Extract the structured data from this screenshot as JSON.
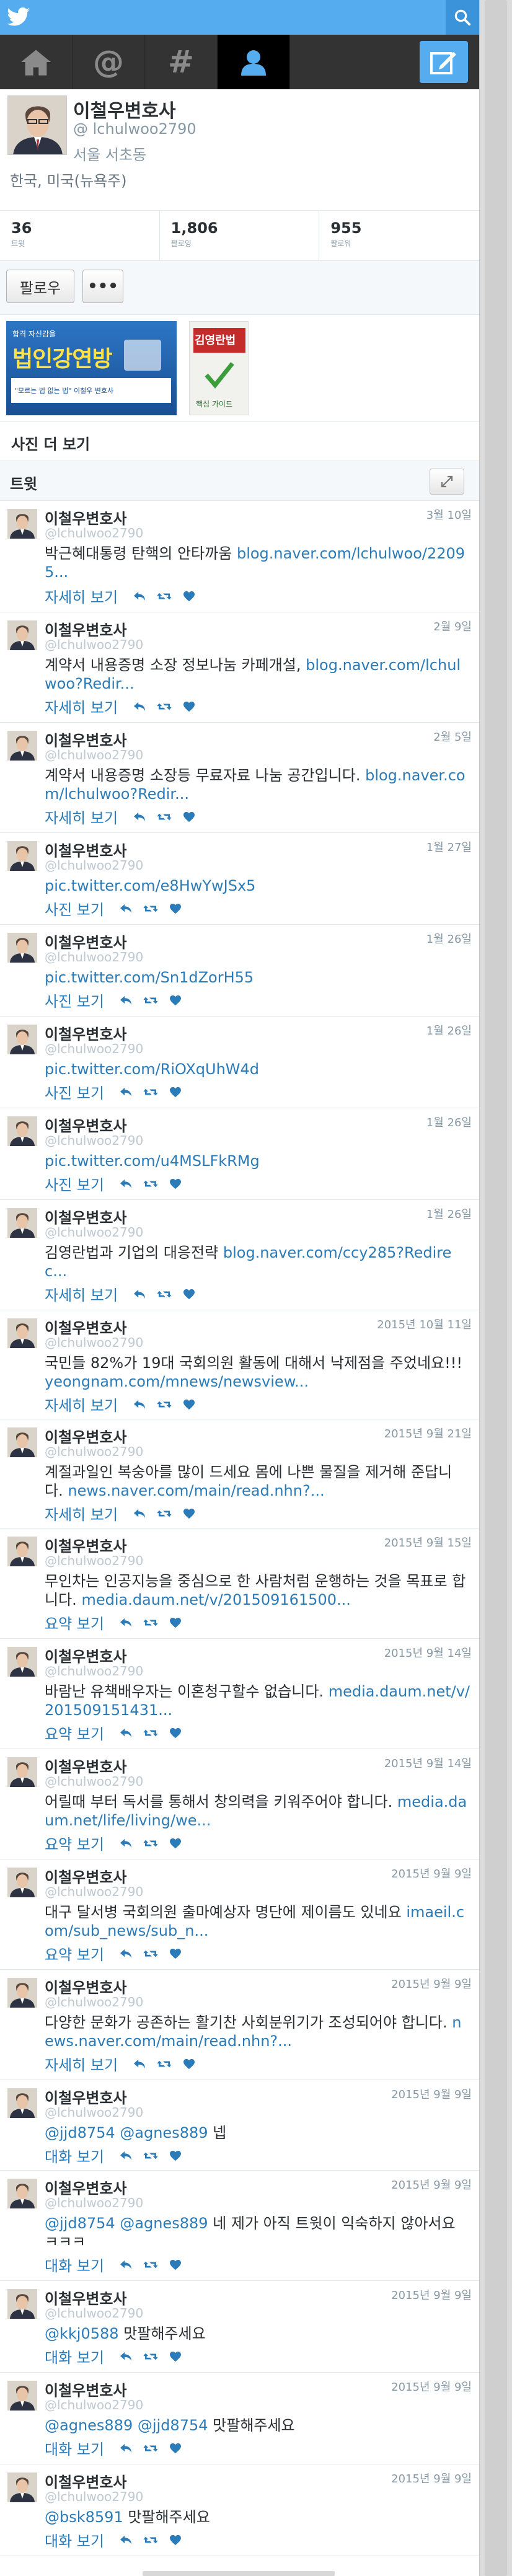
{
  "nav": {
    "items": [
      "home-icon",
      "mentions-icon",
      "hashtag-icon",
      "profile-icon"
    ],
    "active": "profile-icon",
    "compose": "compose-icon",
    "mentions_glyph": "@",
    "hashtag_glyph": "#"
  },
  "colors": {
    "brand_blue": "#55acee",
    "link_blue": "#2b7bb9",
    "nav_dark": "#333333"
  },
  "profile": {
    "name": "이철우변호사",
    "handle": "@ lchulwoo2790",
    "location": "서울 서초동",
    "bio": "한국, 미국(뉴욕주)"
  },
  "stats": [
    {
      "value": "36",
      "label": "트윗"
    },
    {
      "value": "1,806",
      "label": "팔로잉"
    },
    {
      "value": "955",
      "label": "팔로워"
    }
  ],
  "actions": {
    "follow_label": "팔로우",
    "more_label": "•••"
  },
  "photos": {
    "banner_text_top": "합격 자신감을",
    "banner_text_main": "법인강연방",
    "banner_text_sub": "\"모르는 법 없는 법\" 이철우 변호사",
    "book_title": "김영란법",
    "book_sub": "핵심 가이드"
  },
  "sections": {
    "more_photos": "사진 더 보기",
    "tweets": "트윗"
  },
  "tweets": [
    {
      "name": "이철우변호사",
      "handle": "@lchulwoo2790",
      "time": "3월 10일",
      "text": "박근혜대통령 탄핵의 안타까움",
      "link": "blog.naver.com/lchulwoo/22095...",
      "detail": "자세히 보기"
    },
    {
      "name": "이철우변호사",
      "handle": "@lchulwoo2790",
      "time": "2월 9일",
      "text": "계약서 내용증명 소장 정보나눔 카페개설,",
      "link": "blog.naver.com/lchulwoo?Redir...",
      "detail": "자세히 보기"
    },
    {
      "name": "이철우변호사",
      "handle": "@lchulwoo2790",
      "time": "2월 5일",
      "text": "계약서 내용증명 소장등 무료자료 나눔 공간입니다.",
      "link": "blog.naver.com/lchulwoo?Redir...",
      "detail": "자세히 보기"
    },
    {
      "name": "이철우변호사",
      "handle": "@lchulwoo2790",
      "time": "1월 27일",
      "text": "",
      "link": "pic.twitter.com/e8HwYwJSx5",
      "detail": "사진 보기"
    },
    {
      "name": "이철우변호사",
      "handle": "@lchulwoo2790",
      "time": "1월 26일",
      "text": "",
      "link": "pic.twitter.com/Sn1dZorH55",
      "detail": "사진 보기"
    },
    {
      "name": "이철우변호사",
      "handle": "@lchulwoo2790",
      "time": "1월 26일",
      "text": "",
      "link": "pic.twitter.com/RiOXqUhW4d",
      "detail": "사진 보기"
    },
    {
      "name": "이철우변호사",
      "handle": "@lchulwoo2790",
      "time": "1월 26일",
      "text": "",
      "link": "pic.twitter.com/u4MSLFkRMg",
      "detail": "사진 보기"
    },
    {
      "name": "이철우변호사",
      "handle": "@lchulwoo2790",
      "time": "1월 26일",
      "text": "김영란법과 기업의 대응전략",
      "link": "blog.naver.com/ccy285?Redirec...",
      "detail": "자세히 보기"
    },
    {
      "name": "이철우변호사",
      "handle": "@lchulwoo2790",
      "time": "2015년 10월 11일",
      "text": "국민들 82%가 19대 국회의원 활동에 대해서 낙제점을 주었네요!!!",
      "link": "yeongnam.com/mnews/newsview...",
      "detail": "자세히 보기"
    },
    {
      "name": "이철우변호사",
      "handle": "@lchulwoo2790",
      "time": "2015년 9월 21일",
      "text": "계절과일인 복숭아를 많이 드세요 몸에 나쁜 물질을 제거해 준답니다.",
      "link": "news.naver.com/main/read.nhn?...",
      "detail": "자세히 보기"
    },
    {
      "name": "이철우변호사",
      "handle": "@lchulwoo2790",
      "time": "2015년 9월 15일",
      "text": "무인차는 인공지능을 중심으로 한 사람처럼 운행하는 것을 목표로 합니다.",
      "link": "media.daum.net/v/201509161500...",
      "detail": "요약 보기"
    },
    {
      "name": "이철우변호사",
      "handle": "@lchulwoo2790",
      "time": "2015년 9월 14일",
      "text": "바람난 유책배우자는 이혼청구할수 없습니다.",
      "link": "media.daum.net/v/201509151431...",
      "detail": "요약 보기"
    },
    {
      "name": "이철우변호사",
      "handle": "@lchulwoo2790",
      "time": "2015년 9월 14일",
      "text": "어릴때 부터 독서를 통해서 창의력을 키워주어야 합니다.",
      "link": "media.daum.net/life/living/we...",
      "detail": "요약 보기"
    },
    {
      "name": "이철우변호사",
      "handle": "@lchulwoo2790",
      "time": "2015년 9월 9일",
      "text": "대구 달서병 국회의원 출마예상자 명단에 제이름도 있네요",
      "link": "imaeil.com/sub_news/sub_n...",
      "detail": "요약 보기"
    },
    {
      "name": "이철우변호사",
      "handle": "@lchulwoo2790",
      "time": "2015년 9월 9일",
      "text": "다양한 문화가 공존하는 활기찬 사회분위기가 조성되어야 합니다.",
      "link": "news.naver.com/main/read.nhn?...",
      "detail": "자세히 보기"
    },
    {
      "name": "이철우변호사",
      "handle": "@lchulwoo2790",
      "time": "2015년 9월 9일",
      "mention": "@jjd8754 @agnes889",
      "text": "넵",
      "link": "",
      "detail": "대화 보기"
    },
    {
      "name": "이철우변호사",
      "handle": "@lchulwoo2790",
      "time": "2015년 9월 9일",
      "mention": "@jjd8754 @agnes889",
      "text": "네 제가 아직 트윗이 익숙하지 않아서요 ㅋㅋㅋ",
      "link": "",
      "detail": "대화 보기"
    },
    {
      "name": "이철우변호사",
      "handle": "@lchulwoo2790",
      "time": "2015년 9월 9일",
      "mention": "@kkj0588",
      "text": "맛팔해주세요",
      "link": "",
      "detail": "대화 보기"
    },
    {
      "name": "이철우변호사",
      "handle": "@lchulwoo2790",
      "time": "2015년 9월 9일",
      "mention": "@agnes889 @jjd8754",
      "text": "맛팔해주세요",
      "link": "",
      "detail": "대화 보기"
    },
    {
      "name": "이철우변호사",
      "handle": "@lchulwoo2790",
      "time": "2015년 9월 9일",
      "mention": "@bsk8591",
      "text": "맛팔해주세요",
      "link": "",
      "detail": "대화 보기"
    }
  ]
}
